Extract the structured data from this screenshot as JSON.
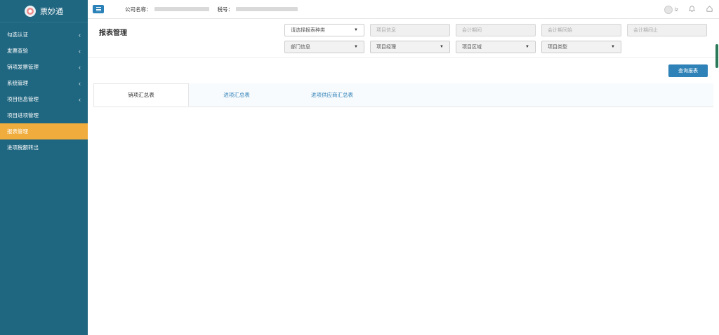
{
  "brand": {
    "name": "票妙通"
  },
  "sidebar": {
    "items": [
      {
        "label": "勾选认证",
        "has_arrow": true,
        "active": false
      },
      {
        "label": "发票查验",
        "has_arrow": true,
        "active": false
      },
      {
        "label": "销项发票管理",
        "has_arrow": true,
        "active": false
      },
      {
        "label": "系统管理",
        "has_arrow": true,
        "active": false
      },
      {
        "label": "项目信息管理",
        "has_arrow": true,
        "active": false
      },
      {
        "label": "项目进项管理",
        "has_arrow": false,
        "active": false
      },
      {
        "label": "报表管理",
        "has_arrow": false,
        "active": true
      },
      {
        "label": "进项税额转出",
        "has_arrow": false,
        "active": false
      }
    ],
    "arrow_glyph": "‹"
  },
  "header": {
    "company_label": "公司名称：",
    "tax_label": "税号：",
    "user_name": "lz"
  },
  "page": {
    "title": "报表管理",
    "filters": {
      "report_type": "请选择报表种类",
      "project_info": "项目信息",
      "period": "会计期间",
      "period_start": "会计期间始",
      "period_end": "会计期间止",
      "department": "部门信息",
      "project_manager": "项目经理",
      "project_region": "项目区域",
      "project_type": "项目类型"
    },
    "query_button": "查询报表",
    "tabs": [
      "销项汇总表",
      "进项汇总表",
      "进项供应商汇总表"
    ]
  },
  "colors": {
    "sidebar_bg": "#1f6680",
    "active_item": "#f0ad3d",
    "primary": "#2f82b7"
  }
}
